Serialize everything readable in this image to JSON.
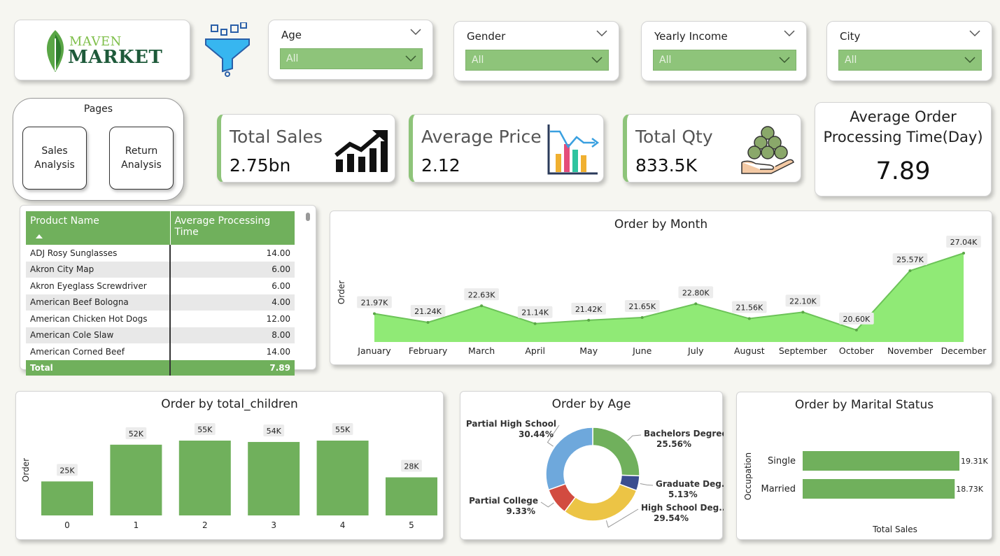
{
  "logo": {
    "line1": "MAVEN",
    "line2": "MARKET"
  },
  "slicers": [
    {
      "label": "Age",
      "value": "All"
    },
    {
      "label": "Gender",
      "value": "All"
    },
    {
      "label": "Yearly Income",
      "value": "All"
    },
    {
      "label": "City",
      "value": "All"
    }
  ],
  "pages": {
    "title": "Pages",
    "sales_label_1": "Sales",
    "sales_label_2": "Analysis",
    "return_label_1": "Return",
    "return_label_2": "Analysis"
  },
  "kpis": {
    "total_sales": {
      "title": "Total Sales",
      "value": "2.75bn"
    },
    "avg_price": {
      "title": "Average Price",
      "value": "2.12"
    },
    "total_qty": {
      "title": "Total Qty",
      "value": "833.5K"
    },
    "avg_processing": {
      "title_1": "Average Order",
      "title_2": "Processing Time(Day)",
      "value": "7.89"
    }
  },
  "product_table": {
    "columns": [
      "Product Name",
      "Average Processing Time"
    ],
    "rows": [
      [
        "ADJ Rosy Sunglasses",
        "14.00"
      ],
      [
        "Akron City Map",
        "6.00"
      ],
      [
        "Akron Eyeglass Screwdriver",
        "6.00"
      ],
      [
        "American Beef Bologna",
        "4.00"
      ],
      [
        "American Chicken Hot Dogs",
        "12.00"
      ],
      [
        "American Cole Slaw",
        "8.00"
      ],
      [
        "American Corned Beef",
        "14.00"
      ]
    ],
    "total": [
      "Total",
      "7.89"
    ]
  },
  "colors": {
    "accent_green": "#70b05c",
    "area_green": "#90ea76",
    "slicer_green": "#8ec47a"
  },
  "chart_data": [
    {
      "type": "area",
      "title": "Order by Month",
      "ylabel": "Order",
      "xlabel": "",
      "categories": [
        "January",
        "February",
        "March",
        "April",
        "May",
        "June",
        "July",
        "August",
        "September",
        "October",
        "November",
        "December"
      ],
      "values": [
        21970,
        21240,
        22630,
        21140,
        21420,
        21650,
        22800,
        21560,
        22100,
        20600,
        25570,
        27040
      ],
      "labels": [
        "21.97K",
        "21.24K",
        "22.63K",
        "21.14K",
        "21.42K",
        "21.65K",
        "22.80K",
        "21.56K",
        "22.10K",
        "20.60K",
        "25.57K",
        "27.04K"
      ],
      "grid": false
    },
    {
      "type": "bar",
      "title": "Order by total_children",
      "ylabel": "Order",
      "xlabel": "",
      "categories": [
        "0",
        "1",
        "2",
        "3",
        "4",
        "5"
      ],
      "values": [
        25000,
        52000,
        55000,
        54000,
        55000,
        28000
      ],
      "labels": [
        "25K",
        "52K",
        "55K",
        "54K",
        "55K",
        "28K"
      ],
      "grid": false
    },
    {
      "type": "pie",
      "title": "Order by Age",
      "categories": [
        "Bachelors Degree",
        "Graduate Deg...",
        "High School Deg...",
        "Partial College",
        "Partial High School"
      ],
      "values": [
        25.56,
        5.13,
        29.54,
        9.33,
        30.44
      ],
      "labels": [
        "25.56%",
        "5.13%",
        "29.54%",
        "9.33%",
        "30.44%"
      ],
      "colors": [
        "#70b05c",
        "#3b4d8f",
        "#ecc445",
        "#d24b40",
        "#6ea8dc"
      ]
    },
    {
      "type": "bar",
      "orientation": "horizontal",
      "title": "Order by Marital Status",
      "ylabel": "Occupation",
      "xlabel": "Total Sales",
      "categories": [
        "Single",
        "Married"
      ],
      "values": [
        19310,
        18730
      ],
      "labels": [
        "19.31K",
        "18.73K"
      ]
    }
  ]
}
